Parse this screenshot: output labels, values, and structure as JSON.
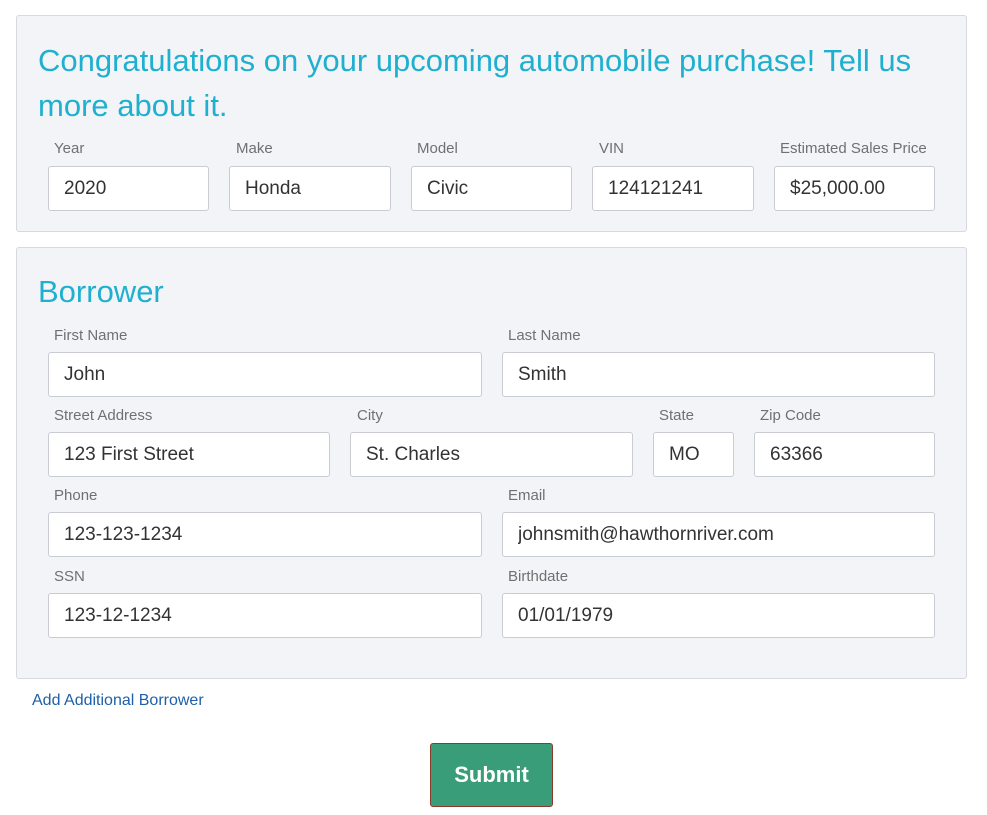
{
  "vehicle": {
    "heading": "Congratulations on your upcoming automobile purchase! Tell us more about it.",
    "fields": {
      "year": {
        "label": "Year",
        "value": "2020"
      },
      "make": {
        "label": "Make",
        "value": "Honda"
      },
      "model": {
        "label": "Model",
        "value": "Civic"
      },
      "vin": {
        "label": "VIN",
        "value": "124121241"
      },
      "price": {
        "label": "Estimated Sales Price",
        "value": "$25,000.00"
      }
    }
  },
  "borrower": {
    "heading": "Borrower",
    "fields": {
      "first_name": {
        "label": "First Name",
        "value": "John"
      },
      "last_name": {
        "label": "Last Name",
        "value": "Smith"
      },
      "street": {
        "label": "Street Address",
        "value": "123 First Street"
      },
      "city": {
        "label": "City",
        "value": "St. Charles"
      },
      "state": {
        "label": "State",
        "value": "MO"
      },
      "zip": {
        "label": "Zip Code",
        "value": "63366"
      },
      "phone": {
        "label": "Phone",
        "value": "123-123-1234"
      },
      "email": {
        "label": "Email",
        "value": "johnsmith@hawthornriver.com"
      },
      "ssn": {
        "label": "SSN",
        "value": "123-12-1234"
      },
      "birthdate": {
        "label": "Birthdate",
        "value": "01/01/1979"
      }
    }
  },
  "actions": {
    "add_borrower_label": "Add Additional Borrower",
    "submit_label": "Submit"
  },
  "colors": {
    "heading": "#1fb0cf",
    "panel_bg": "#f3f4f8",
    "link": "#1f5fa8",
    "submit_bg": "#3a9d7a"
  }
}
